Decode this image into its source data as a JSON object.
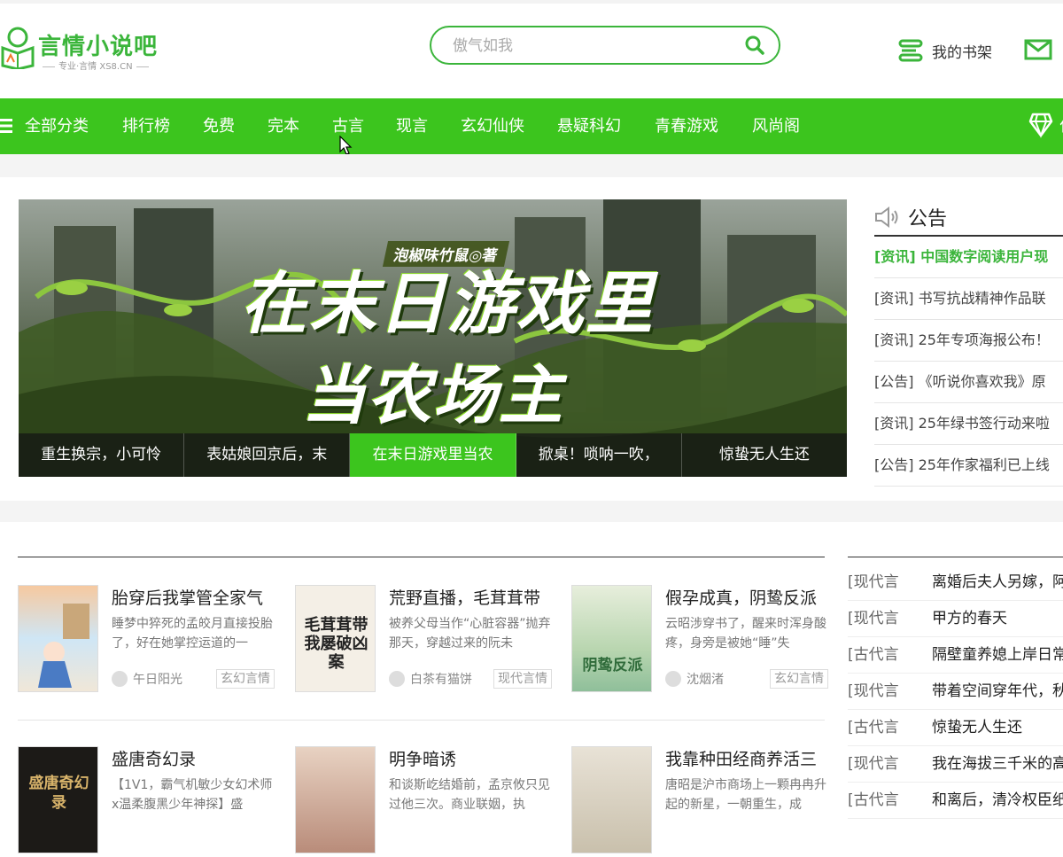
{
  "header": {
    "logo_title": "言情小说吧",
    "logo_sub": "专业·言情  XS8.CN",
    "search_placeholder": "傲气如我",
    "bookshelf_label": "我的书架"
  },
  "nav": {
    "items": [
      "全部分类",
      "排行榜",
      "免费",
      "完本",
      "古言",
      "现言",
      "玄幻仙侠",
      "悬疑科幻",
      "青春游戏",
      "风尚阁"
    ],
    "partial_right": "仁"
  },
  "banner": {
    "author": "泡椒味竹鼠◎著",
    "title_line1": "在末日游戏里",
    "title_line2": "当农场主",
    "tabs": [
      "重生换宗，小可怜",
      "表姑娘回京后，末",
      "在末日游戏里当农",
      "掀桌！唢呐一吹，",
      "惊蛰无人生还"
    ],
    "active_tab_index": 2
  },
  "notice": {
    "title": "公告",
    "items": [
      "[资讯] 中国数字阅读用户现",
      "[资讯] 书写抗战精神作品联",
      "[资讯] 25年专项海报公布！",
      "[公告] 《听说你喜欢我》原",
      "[资讯] 25年绿书签行动来啦",
      "[公告] 25年作家福利已上线"
    ]
  },
  "books": [
    {
      "title": "胎穿后我掌管全家气",
      "desc": "睡梦中猝死的孟皎月直接投胎了，好在她掌控运道的一",
      "author": "午日阳光",
      "tag": "玄幻言情",
      "cover_text": ""
    },
    {
      "title": "荒野直播，毛茸茸带",
      "desc": "被养父母当作“心脏容器”抛弃那天，穿越过来的阮未",
      "author": "白茶有猫饼",
      "tag": "现代言情",
      "cover_text": "毛茸茸带我屡破凶案"
    },
    {
      "title": "假孕成真，阴鸷反派",
      "desc": "云昭涉穿书了，醒来时浑身酸疼，身旁是被她“睡”失",
      "author": "沈烟渚",
      "tag": "玄幻言情",
      "cover_text": "阴鸷反派"
    },
    {
      "title": "盛唐奇幻录",
      "desc": "【1V1，霸气机敏少女幻术师x温柔腹黑少年神探】盛",
      "author": "",
      "tag": "",
      "cover_text": "盛唐奇幻录"
    },
    {
      "title": "明争暗诱",
      "desc": "和谈斯屹结婚前，孟京攸只见过他三次。商业联姻，执",
      "author": "",
      "tag": "",
      "cover_text": ""
    },
    {
      "title": "我靠种田经商养活三",
      "desc": "唐昭是沪市商场上一颗冉冉升起的新星，一朝重生，成",
      "author": "",
      "tag": "",
      "cover_text": ""
    }
  ],
  "rank_list": [
    {
      "cat": "[现代言",
      "name": "离婚后夫人另嫁，阿"
    },
    {
      "cat": "[现代言",
      "name": "甲方的春天"
    },
    {
      "cat": "[古代言",
      "name": "隔壁童养媳上岸日常"
    },
    {
      "cat": "[现代言",
      "name": "带着空间穿年代，秋"
    },
    {
      "cat": "[古代言",
      "name": "惊蛰无人生还"
    },
    {
      "cat": "[现代言",
      "name": "我在海拔三千米的高"
    },
    {
      "cat": "[古代言",
      "name": "和离后，清冷权臣纸"
    }
  ],
  "colors": {
    "brand_green": "#3cc51e",
    "logo_green": "#3bb53b"
  }
}
